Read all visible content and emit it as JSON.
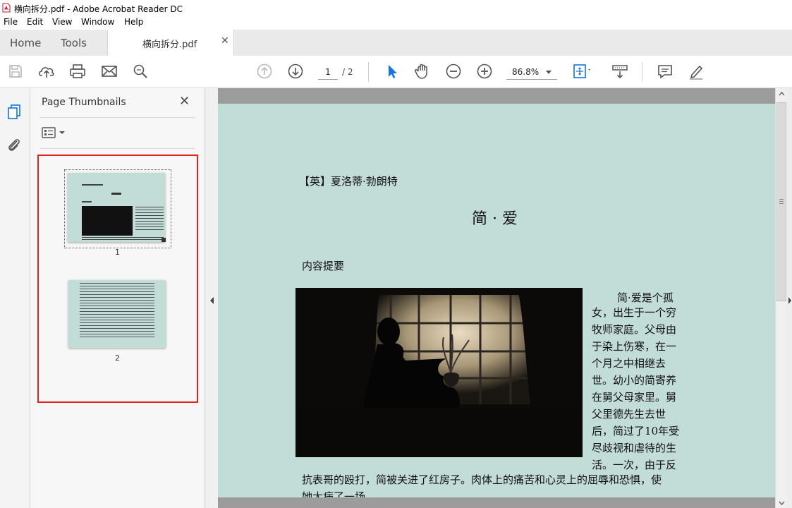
{
  "window": {
    "title": "横向拆分.pdf - Adobe Acrobat Reader DC"
  },
  "menu": [
    "File",
    "Edit",
    "View",
    "Window",
    "Help"
  ],
  "tabs": {
    "home": "Home",
    "tools": "Tools",
    "document": "横向拆分.pdf"
  },
  "toolbar": {
    "page_current": "1",
    "page_total": "/ 2",
    "zoom": "86.8%"
  },
  "panel": {
    "title": "Page Thumbnails",
    "thumbnails": [
      "1",
      "2"
    ]
  },
  "document": {
    "author_line": "【英】夏洛蒂·勃朗特",
    "title": "简 · 爱",
    "section": "内容提要",
    "text_lines": [
      "简·爱是个孤",
      "女，出生于一个穷",
      "牧师家庭。父母由",
      "于染上伤寒，在一",
      "个月之中相继去",
      "世。幼小的简寄养",
      "在舅父母家里。舅",
      "父里德先生去世",
      "后，简过了10年受",
      "尽歧视和虐待的生",
      "活。一次，由于反"
    ],
    "full_lines": [
      "抗表哥的殴打，简被关进了红房子。肉体上的痛苦和心灵上的屈辱和恐惧，使",
      "她大病了一场。"
    ]
  },
  "colors": {
    "page_bg": "#c2dcd8",
    "selection": "#e0251f",
    "accent": "#1473e6"
  }
}
